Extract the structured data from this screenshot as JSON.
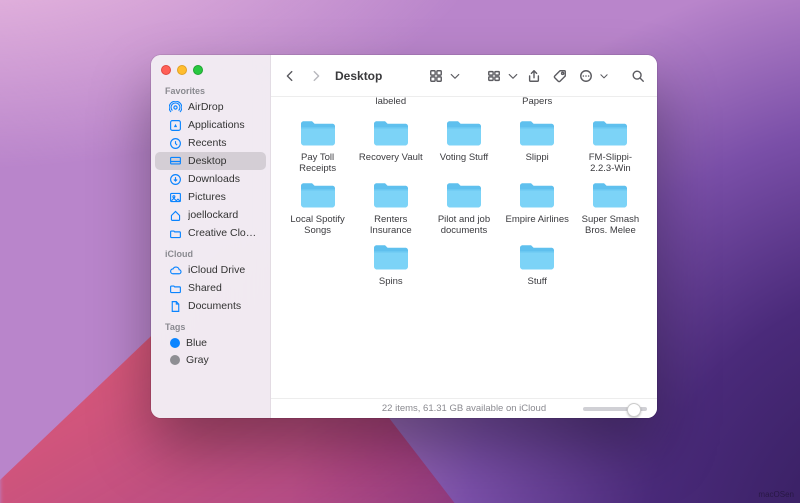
{
  "window": {
    "title": "Desktop"
  },
  "sidebar": {
    "sections": [
      {
        "title": "Favorites",
        "items": [
          {
            "icon": "airdrop",
            "label": "AirDrop"
          },
          {
            "icon": "apps",
            "label": "Applications"
          },
          {
            "icon": "recents",
            "label": "Recents"
          },
          {
            "icon": "desktop",
            "label": "Desktop",
            "selected": true
          },
          {
            "icon": "downloads",
            "label": "Downloads"
          },
          {
            "icon": "pictures",
            "label": "Pictures"
          },
          {
            "icon": "home",
            "label": "joellockard"
          },
          {
            "icon": "cloudfolder",
            "label": "Creative Cloud…"
          }
        ]
      },
      {
        "title": "iCloud",
        "items": [
          {
            "icon": "icloud",
            "label": "iCloud Drive"
          },
          {
            "icon": "shared",
            "label": "Shared"
          },
          {
            "icon": "doc",
            "label": "Documents"
          }
        ]
      },
      {
        "title": "Tags",
        "items": [
          {
            "icon": "tag-blue",
            "label": "Blue"
          },
          {
            "icon": "tag-gray",
            "label": "Gray"
          }
        ]
      }
    ]
  },
  "folders": {
    "row0": [
      {
        "name": "labeled"
      },
      {
        "name": "Papers"
      }
    ],
    "rows": [
      [
        {
          "name": "Pay Toll Receipts"
        },
        {
          "name": "Recovery Vault"
        },
        {
          "name": "Voting Stuff"
        },
        {
          "name": "Slippi"
        },
        {
          "name": "FM-Slippi-2.2.3-Win"
        }
      ],
      [
        {
          "name": "Local Spotify Songs"
        },
        {
          "name": "Renters Insurance"
        },
        {
          "name": "Pilot and job documents"
        },
        {
          "name": "Empire Airlines"
        },
        {
          "name": "Super Smash Bros. Melee"
        }
      ],
      [
        {
          "name": "Spins"
        },
        {
          "name": "Stuff"
        }
      ]
    ]
  },
  "status": {
    "text": "22 items, 61.31 GB available on iCloud"
  },
  "watermark": "macOSen"
}
